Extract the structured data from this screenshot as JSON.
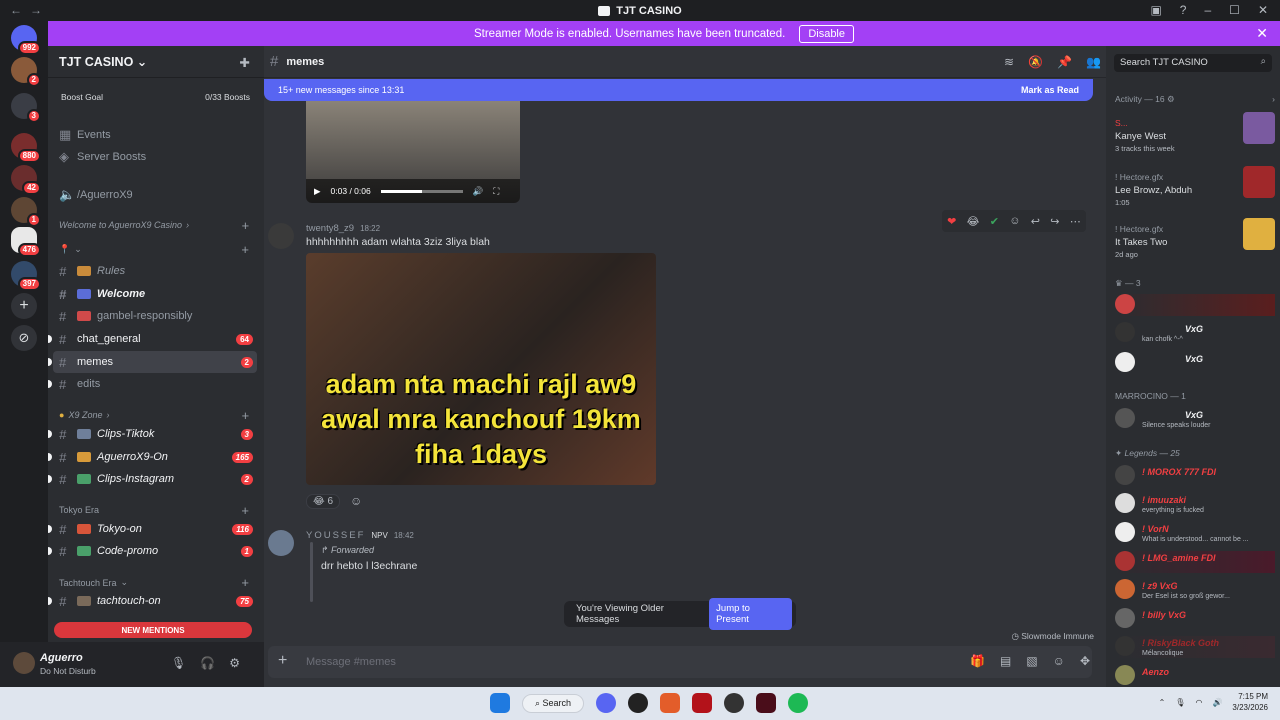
{
  "titlebar": {
    "title": "TJT CASINO"
  },
  "banner": {
    "text": "Streamer Mode is enabled. Usernames have been truncated.",
    "button": "Disable"
  },
  "guilds": [
    {
      "badge": "992",
      "color": "#5865f2"
    },
    {
      "badge": "2",
      "color": "#8a5a3a"
    },
    {
      "badge": "3",
      "color": "#3a3d45"
    },
    {
      "badge": "880",
      "color": "#7a2d2d"
    },
    {
      "badge": "42",
      "color": "#6a2d2d"
    },
    {
      "badge": "1",
      "color": "#5e4634"
    },
    {
      "badge": "476",
      "color": "#e8e8e8"
    },
    {
      "badge": "397",
      "color": "#324a6a"
    }
  ],
  "server": {
    "name": "TJT CASINO",
    "boost_goal": "Boost Goal",
    "boost_count": "0/33 Boosts",
    "events": "Events",
    "server_boosts": "Server Boosts",
    "voice_channel": "/AguerroX9",
    "categories": [
      {
        "name": "Welcome to AguerroX9 Casino"
      },
      {
        "name": "X9 Zone"
      },
      {
        "name": "Tokyo Era"
      },
      {
        "name": "Tachtouch Era"
      }
    ],
    "channels": [
      {
        "name": "Rules",
        "badge": ""
      },
      {
        "name": "Welcome",
        "badge": ""
      },
      {
        "name": "gambel-responsibly",
        "badge": ""
      },
      {
        "name": "chat_general",
        "badge": "64"
      },
      {
        "name": "memes",
        "badge": "2"
      },
      {
        "name": "edits",
        "badge": ""
      },
      {
        "name": "Clips-Tiktok",
        "badge": "3"
      },
      {
        "name": "AguerroX9-On",
        "badge": "165"
      },
      {
        "name": "Clips-Instagram",
        "badge": "2"
      },
      {
        "name": "Tokyo-on",
        "badge": "116"
      },
      {
        "name": "Code-promo",
        "badge": "1"
      },
      {
        "name": "tachtouch-on",
        "badge": "75"
      }
    ],
    "new_mentions": "NEW MENTIONS"
  },
  "user": {
    "name": "Aguerro",
    "status": "Do Not Disturb"
  },
  "channel_header": {
    "name": "memes",
    "search_placeholder": "Search TJT CASINO"
  },
  "newbar": {
    "text": "15+ new messages since 13:31",
    "action": "Mark as Read"
  },
  "video": {
    "time": "0:03 / 0:06",
    "progress": 0.5
  },
  "messages": [
    {
      "author": "twenty8_z9",
      "time": "18:22",
      "text": "hhhhhhhhh  adam wlahta 3ziz 3liya blah",
      "image_caption_lines": [
        "adam nta machi rajl aw9",
        "awal mra kanchouf 19km",
        "fiha 1days"
      ],
      "reactions": [
        {
          "emoji": "😂",
          "count": "6"
        }
      ]
    },
    {
      "author": "YOUSSEF",
      "badge": "NPV",
      "time": "18:42",
      "forwarded": "Forwarded",
      "text": "drr hebto l l3echrane"
    }
  ],
  "older": {
    "text": "You're Viewing Older Messages",
    "button": "Jump to Present"
  },
  "slowmode": "Slowmode Immune",
  "composer": {
    "placeholder": "Message #memes"
  },
  "members": {
    "activity_header": "Activity — 16",
    "activities": [
      {
        "user": "S...",
        "title": "Kanye West",
        "sub": "3 tracks this week",
        "art": "#7a5aa0"
      },
      {
        "user": "! Hectore.gfx",
        "title": "Lee Browz, Abduh",
        "sub": "1:05",
        "art": "#a0282a"
      },
      {
        "user": "! Hectore.gfx",
        "title": "It Takes Two",
        "sub": "2d ago",
        "art": "#e0b040"
      }
    ],
    "group1_header": "— 3",
    "group1": [
      {
        "name": "",
        "tag": "",
        "color": "#f23f42",
        "av": "#c44"
      },
      {
        "name": "VxG",
        "tag": "kan chofk ^-^",
        "color": "#f2f3f5",
        "av": "#333"
      },
      {
        "name": "VxG",
        "tag": "",
        "color": "#f2f3f5",
        "av": "#eee"
      }
    ],
    "group2_header": "MARROCINO — 1",
    "group2": [
      {
        "name": "VxG",
        "tag": "Silence speaks louder",
        "color": "#f2f3f5",
        "av": "#555"
      }
    ],
    "group3_header": "Legends — 25",
    "group3": [
      {
        "name": "! MOROX 777  FDI",
        "tag": "",
        "color": "#f23f42",
        "av": "#444"
      },
      {
        "name": "! imuuzaki",
        "tag": "everything is fucked",
        "color": "#f23f42",
        "av": "#ddd"
      },
      {
        "name": "! VorN",
        "tag": "What is understood... cannot be ...",
        "color": "#f23f42",
        "av": "#eee"
      },
      {
        "name": "! LMG_amine  FDI",
        "tag": "",
        "color": "#f23f42",
        "av": "#a33"
      },
      {
        "name": "! z9  VxG",
        "tag": "Der Esel ist so groß gewor...",
        "color": "#f23f42",
        "av": "#c63"
      },
      {
        "name": "! billy  VxG",
        "tag": "",
        "color": "#f23f42",
        "av": "#666"
      },
      {
        "name": "! RiskyBlack  Goth",
        "tag": "Mélancolique",
        "color": "#a0282a",
        "av": "#333"
      },
      {
        "name": "Aenzo",
        "tag": "",
        "color": "#f23f42",
        "av": "#885"
      }
    ]
  },
  "taskbar": {
    "search": "Search",
    "time": "7:15 PM",
    "date": "3/23/2026"
  }
}
